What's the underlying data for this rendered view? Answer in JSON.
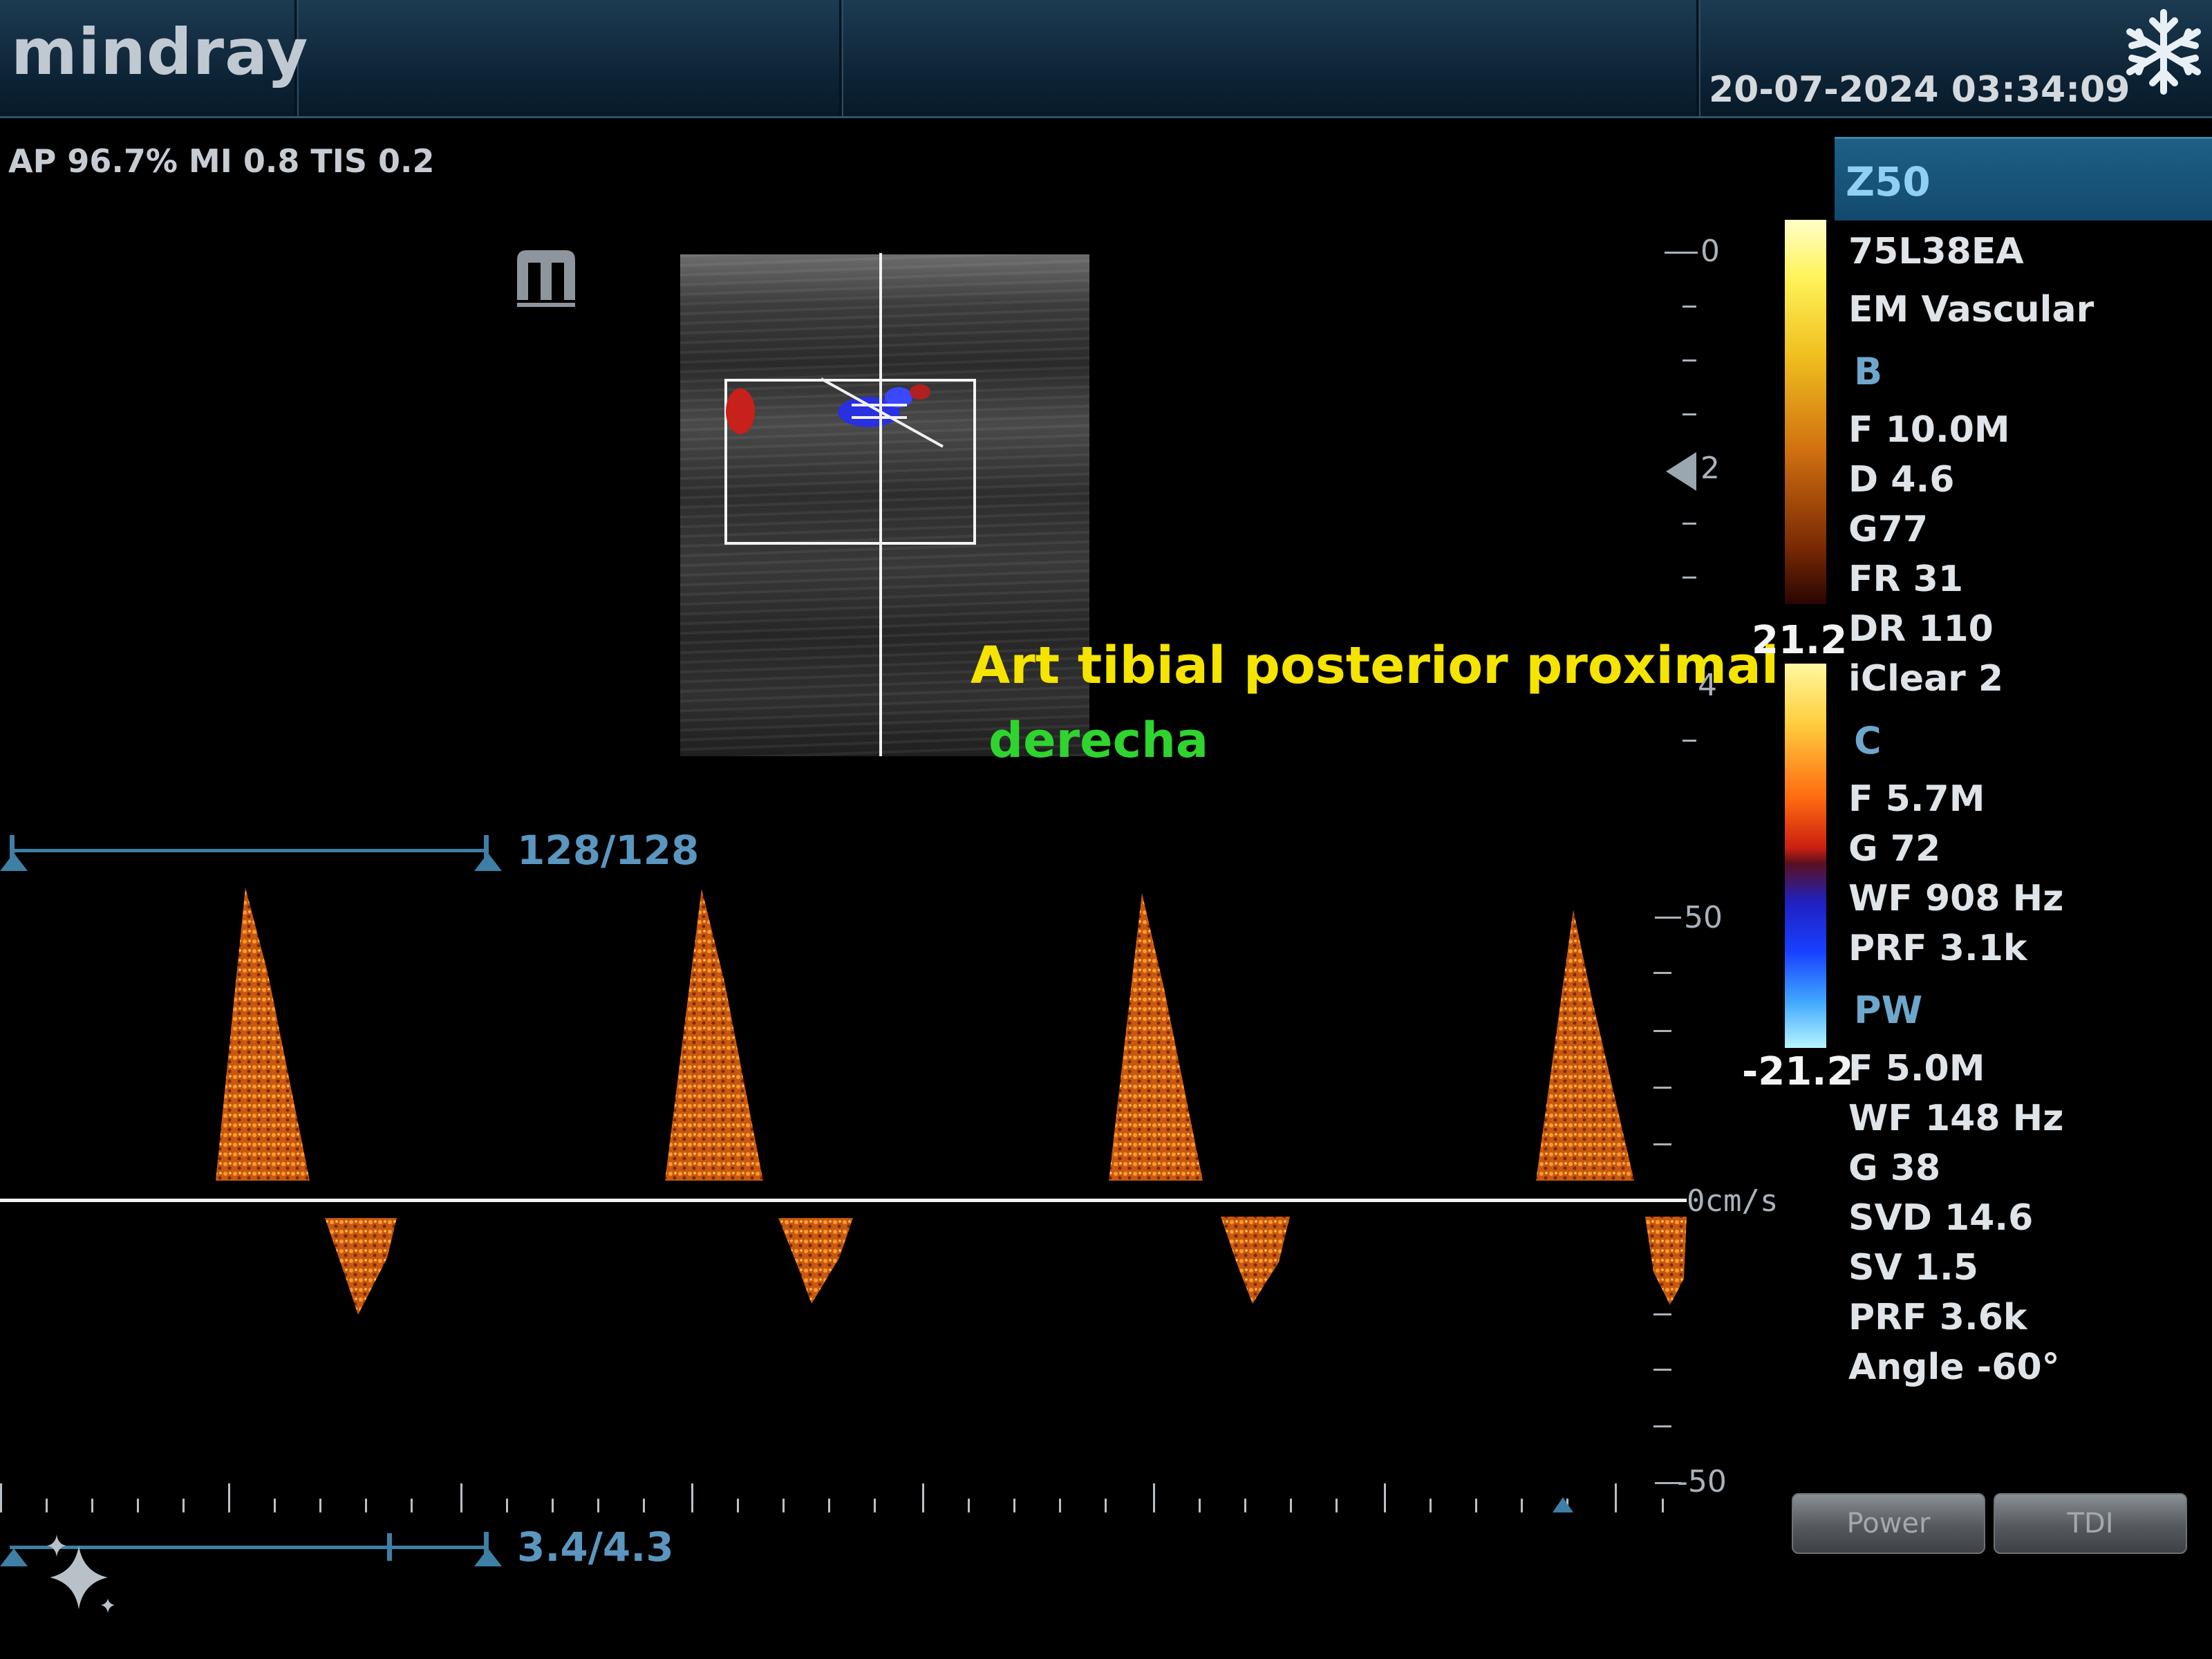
{
  "header": {
    "logo": "mindray",
    "datetime": "20-07-2024  03:34:09",
    "freeze_icon": "snowflake-icon"
  },
  "acoustic": {
    "text": "AP 96.7%  MI 0.8 TIS 0.2"
  },
  "image": {
    "label_line1": "Art tibial posterior proximal",
    "label_line2": "derecha"
  },
  "depth_scale": {
    "labels": [
      "0",
      "2",
      "4"
    ]
  },
  "sliders": {
    "top_value": "128/128",
    "bottom_value": "3.4/4.3"
  },
  "doppler_scale": {
    "top": "50",
    "zero": "0cm/s",
    "bottom": "-50"
  },
  "colorbar": {
    "max": "21.2",
    "min": "-21.2"
  },
  "params": {
    "model": "Z50",
    "probe": "75L38EA",
    "preset": "EM Vascular",
    "b_head": "B",
    "b": [
      "F 10.0M",
      "D 4.6",
      "G77",
      "FR 31",
      "DR 110",
      "iClear 2"
    ],
    "c_head": "C",
    "c": [
      "F 5.7M",
      "G 72",
      "WF 908 Hz",
      "PRF 3.1k"
    ],
    "pw_head": "PW",
    "pw": [
      "F 5.0M",
      "WF 148 Hz",
      "G 38",
      "SVD 14.6",
      "SV 1.5",
      "PRF 3.6k",
      "Angle -60°"
    ]
  },
  "buttons": {
    "power": "Power",
    "tdi": "TDI"
  },
  "colors": {
    "accent": "#3e7fa6",
    "label_yellow": "#f5e400",
    "label_green": "#2fd42f",
    "doppler_orange": "#e8781c"
  }
}
